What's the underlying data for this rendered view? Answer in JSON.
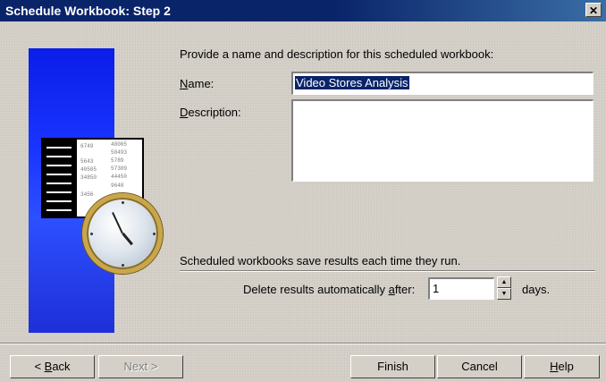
{
  "window": {
    "title": "Schedule Workbook: Step 2",
    "close_glyph": "✕"
  },
  "prompt": "Provide a name and description for this scheduled workbook:",
  "name_field": {
    "label_accel": "N",
    "label_rest": "ame:",
    "value": "Video Stores Analysis"
  },
  "description_field": {
    "label_accel": "D",
    "label_rest": "escription:",
    "value": ""
  },
  "illustration": {
    "icon": "workbook-clock-icon",
    "numbers": [
      "6749",
      "48005",
      "58493",
      "5643",
      "5789",
      "40505",
      "57389",
      "34850",
      "44450",
      "3456",
      "9648"
    ]
  },
  "info_text": "Scheduled workbooks save results each time they run.",
  "delete": {
    "label_pre": "Delete results automatically ",
    "label_accel": "a",
    "label_post": "fter:",
    "value": "1",
    "unit": "days."
  },
  "buttons": {
    "back": {
      "prefix": "< ",
      "accel": "B",
      "rest": "ack"
    },
    "next": {
      "label": "Next >",
      "disabled": true
    },
    "finish": "Finish",
    "cancel": "Cancel",
    "help": {
      "accel": "H",
      "rest": "elp"
    }
  },
  "colors": {
    "titlebar": "#0a246a",
    "face": "#d4d0c8",
    "selection": "#0a246a",
    "art_blue": "#1a34ff"
  }
}
